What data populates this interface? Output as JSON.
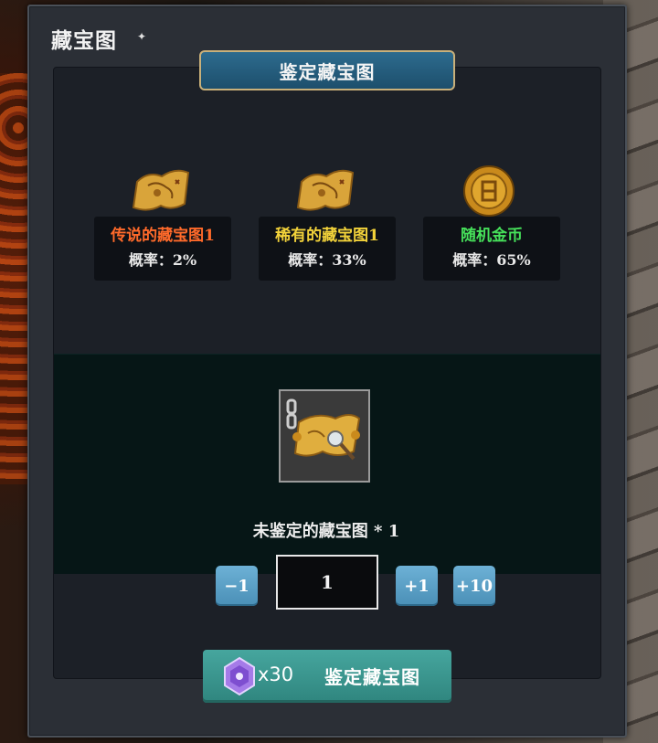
{
  "window": {
    "title": "藏宝图",
    "title_mark": "✦"
  },
  "header_tab": {
    "label": "鉴定藏宝图"
  },
  "rewards": [
    {
      "name": "传说的藏宝图1",
      "probability": "概率：2%",
      "color": "#ff6a2a",
      "icon": "treasure-map-icon"
    },
    {
      "name": "稀有的藏宝图1",
      "probability": "概率：33%",
      "color": "#f2d23a",
      "icon": "treasure-map-icon"
    },
    {
      "name": "随机金币",
      "probability": "概率：65%",
      "color": "#46e05a",
      "icon": "gold-coin-icon"
    }
  ],
  "item": {
    "name": "未鉴定的藏宝图 * 1",
    "icon": "locked-treasure-map-icon"
  },
  "quantity": {
    "minus_label": "−1",
    "value": "1",
    "plus1_label": "+1",
    "plus10_label": "+10"
  },
  "confirm": {
    "cost": "x30",
    "label": "鉴定藏宝图",
    "cost_icon": "purple-gem-icon"
  },
  "colors": {
    "accent": "#2d6b8e",
    "button": "#5ea3c9",
    "confirm": "#3c968e"
  }
}
